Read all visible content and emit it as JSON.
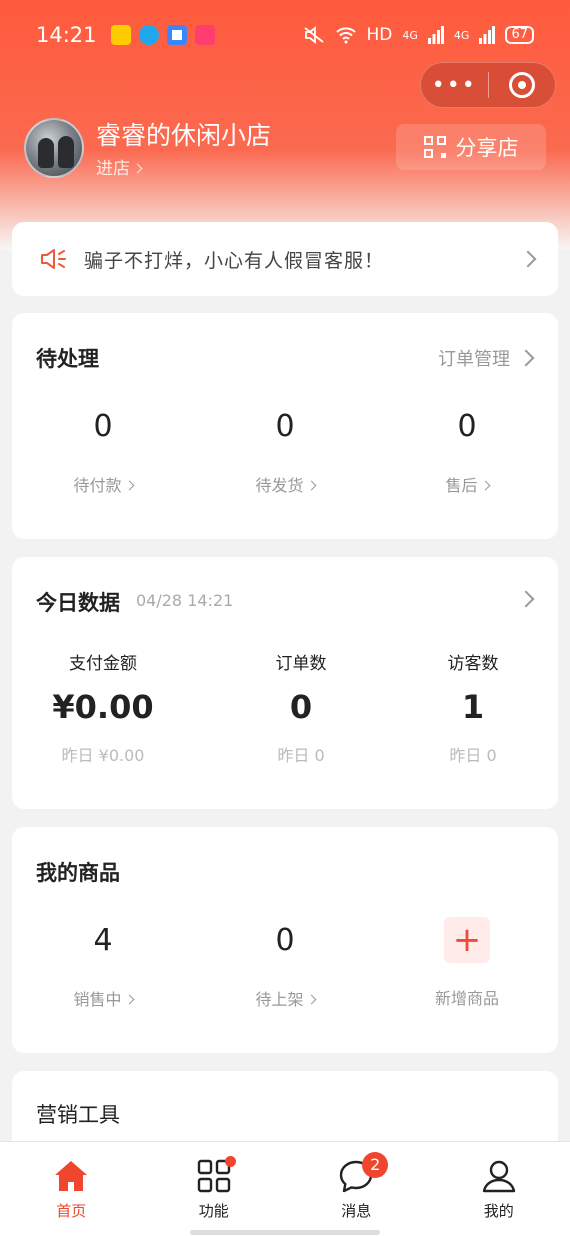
{
  "status_bar": {
    "time": "14:21",
    "network": "HD",
    "signal_1": "4G",
    "signal_2": "4G",
    "battery": "67"
  },
  "capsule": {
    "more_icon": "more-dots-icon",
    "close_icon": "target-circle-icon"
  },
  "shop": {
    "name": "睿睿的休闲小店",
    "enter_label": "进店",
    "share_label": "分享店"
  },
  "notice": {
    "text": "骗子不打烊，小心有人假冒客服！"
  },
  "pending": {
    "title": "待处理",
    "link": "订单管理",
    "stats": [
      {
        "value": "0",
        "label": "待付款"
      },
      {
        "value": "0",
        "label": "待发货"
      },
      {
        "value": "0",
        "label": "售后"
      }
    ]
  },
  "today": {
    "title": "今日数据",
    "timestamp": "04/28 14:21",
    "stats": [
      {
        "label": "支付金额",
        "value": "¥0.00",
        "yesterday": "昨日 ¥0.00"
      },
      {
        "label": "订单数",
        "value": "0",
        "yesterday": "昨日 0"
      },
      {
        "label": "访客数",
        "value": "1",
        "yesterday": "昨日 0"
      }
    ]
  },
  "goods": {
    "title": "我的商品",
    "stats": [
      {
        "value": "4",
        "label": "销售中"
      },
      {
        "value": "0",
        "label": "待上架"
      }
    ],
    "add_label": "新增商品",
    "add_symbol": "+"
  },
  "marketing": {
    "title": "营销工具"
  },
  "tabbar": {
    "items": [
      {
        "label": "首页",
        "icon": "home-icon"
      },
      {
        "label": "功能",
        "icon": "grid-icon"
      },
      {
        "label": "消息",
        "icon": "chat-bubble-icon",
        "badge": "2"
      },
      {
        "label": "我的",
        "icon": "person-icon"
      }
    ]
  },
  "colors": {
    "accent": "#f0462e",
    "header": "#ff5a3c"
  }
}
